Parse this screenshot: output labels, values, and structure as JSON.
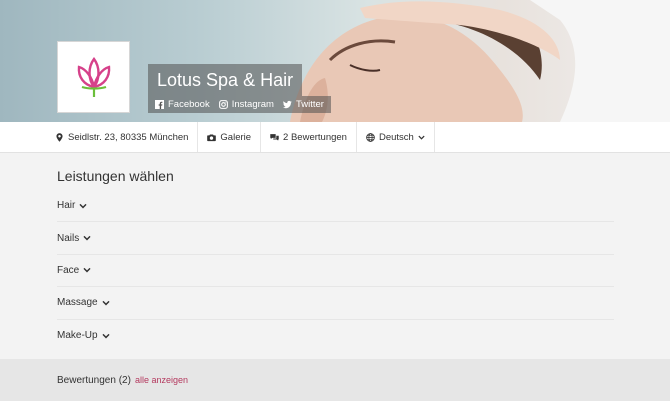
{
  "brand": {
    "name": "Lotus Spa & Hair",
    "logo_color_primary": "#d6418a",
    "logo_color_leaf": "#6bbf3a"
  },
  "social": [
    {
      "label": "Facebook",
      "icon": "facebook-icon"
    },
    {
      "label": "Instagram",
      "icon": "instagram-icon"
    },
    {
      "label": "Twitter",
      "icon": "twitter-icon"
    }
  ],
  "info_bar": {
    "address": "Seidlstr. 23, 80335 München",
    "gallery": "Galerie",
    "reviews": "2 Bewertungen",
    "language": "Deutsch"
  },
  "services": {
    "heading": "Leistungen wählen",
    "items": [
      "Hair",
      "Nails",
      "Face",
      "Massage",
      "Make-Up"
    ]
  },
  "reviews_section": {
    "title": "Bewertungen (2)",
    "link": "alle anzeigen"
  },
  "colors": {
    "accent": "#b43a5f"
  }
}
